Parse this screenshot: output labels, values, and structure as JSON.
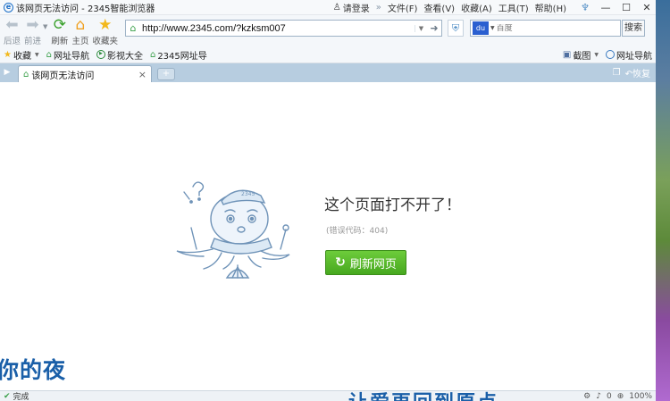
{
  "window": {
    "title": "该网页无法访问 - 2345智能浏览器",
    "login_label": "请登录",
    "menu": [
      "文件(F)",
      "查看(V)",
      "收藏(A)",
      "工具(T)",
      "帮助(H)"
    ]
  },
  "toolbar": {
    "back_label": "后退",
    "forward_label": "前进",
    "refresh_label": "刷新",
    "home_label": "主页",
    "favorites_label": "收藏夹",
    "url": "http://www.2345.com/?kzksm007",
    "search_placeholder": "百度",
    "search_button": "搜索"
  },
  "bookmarks": {
    "items": [
      "收藏",
      "网址导航",
      "影视大全",
      "2345网址导"
    ],
    "screenshot_label": "截图",
    "nav_label": "网址导航"
  },
  "tabs": [
    {
      "label": "该网页无法访问",
      "close": "×"
    }
  ],
  "tab_bar_right": "恢复",
  "error_page": {
    "heading": "这个页面打不开了！",
    "code": "(错误代码：404)",
    "refresh_button": "刷新网页"
  },
  "status": {
    "text": "完成",
    "zoom": "100%",
    "counter": "0"
  },
  "captions": {
    "left": "你的夜",
    "bottom": "让爱再回到原点"
  }
}
